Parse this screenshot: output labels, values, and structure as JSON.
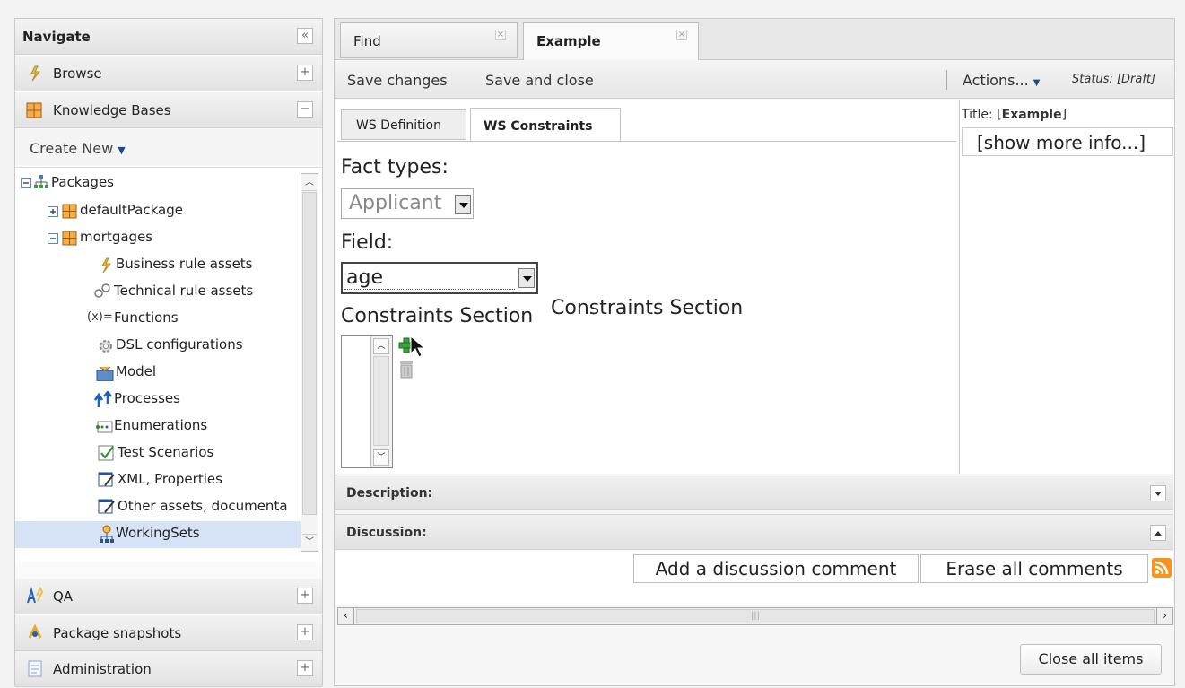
{
  "navigate": {
    "title": "Navigate",
    "collapse": "«"
  },
  "accordion": {
    "browse": "Browse",
    "knowledge_bases": "Knowledge Bases",
    "create_new": "Create New",
    "qa": "QA",
    "package_snapshots": "Package snapshots",
    "administration": "Administration"
  },
  "tree": {
    "packages": "Packages",
    "default_package": "defaultPackage",
    "mortgages": "mortgages",
    "items": [
      "Business rule assets",
      "Technical rule assets",
      "Functions",
      "DSL configurations",
      "Model",
      "Processes",
      "Enumerations",
      "Test Scenarios",
      "XML, Properties",
      "Other assets, documenta",
      "WorkingSets"
    ],
    "functions_prefix": "(x)="
  },
  "tabs": [
    {
      "label": "Find"
    },
    {
      "label": "Example"
    }
  ],
  "toolbar": {
    "save_changes": "Save changes",
    "save_and_close": "Save and close",
    "actions": "Actions...",
    "status": "Status: [Draft]"
  },
  "subtabs": [
    {
      "label": "WS Definition"
    },
    {
      "label": "WS Constraints"
    }
  ],
  "editor": {
    "fact_types_label": "Fact types:",
    "fact_type_value": "Applicant",
    "field_label": "Field:",
    "field_value": "age",
    "constraints_label_1": "Constraints Section",
    "constraints_label_2": "Constraints Section"
  },
  "info": {
    "title_prefix": "Title: [",
    "title_value": "Example",
    "title_suffix": "]",
    "show_more": "[show more info...]"
  },
  "sections": {
    "description": "Description:",
    "discussion": "Discussion:"
  },
  "discussion": {
    "add_comment": "Add a discussion comment",
    "erase_comments": "Erase all comments"
  },
  "footer": {
    "close_all": "Close all items"
  },
  "colors": {
    "selection": "#d6e3f6",
    "rss": "#f7941d"
  }
}
